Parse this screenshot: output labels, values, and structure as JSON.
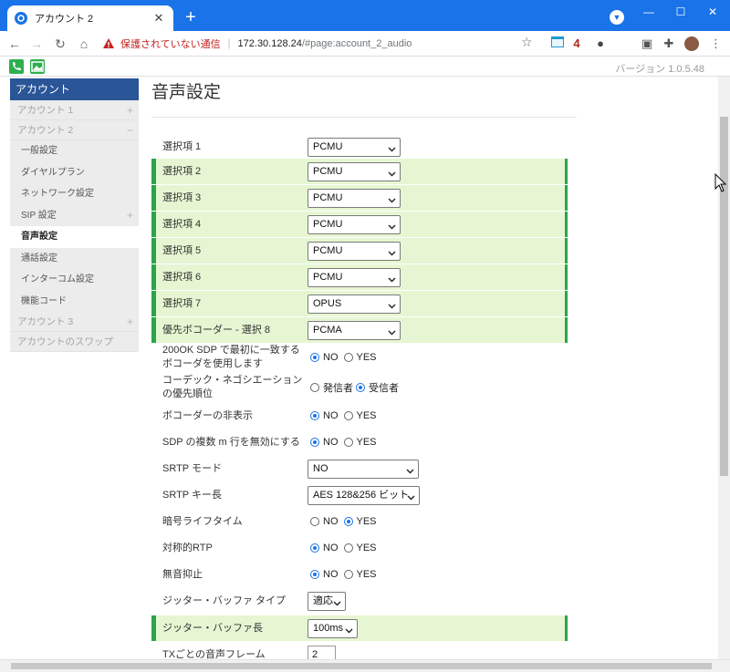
{
  "browser": {
    "tab_title": "アカウント 2",
    "tab_close": "✕",
    "new_tab": "+",
    "window_min": "—",
    "window_max": "☐",
    "window_close": "✕",
    "security_label": "保護されていない通信",
    "url_host": "172.30.128.24",
    "url_path": "/#page:account_2_audio",
    "ext_badge": "4"
  },
  "app": {
    "version": "バージョン 1.0.5.48"
  },
  "sidebar": {
    "header": "アカウント",
    "accounts": [
      {
        "label": "アカウント 1",
        "sign": "+"
      },
      {
        "label": "アカウント 2",
        "sign": "−"
      }
    ],
    "sub_items": [
      {
        "label": "一般設定"
      },
      {
        "label": "ダイヤルプラン"
      },
      {
        "label": "ネットワーク設定"
      },
      {
        "label": "SIP 設定",
        "sign": "+"
      },
      {
        "label": "音声設定"
      },
      {
        "label": "通話設定"
      },
      {
        "label": "インターコム設定"
      },
      {
        "label": "機能コード"
      }
    ],
    "account3": {
      "label": "アカウント 3",
      "sign": "+"
    },
    "swap": "アカウントのスワップ"
  },
  "main": {
    "title": "音声設定",
    "codecs": [
      {
        "label": "選択項 1",
        "value": "PCMU"
      },
      {
        "label": "選択項 2",
        "value": "PCMU"
      },
      {
        "label": "選択項 3",
        "value": "PCMU"
      },
      {
        "label": "選択項 4",
        "value": "PCMU"
      },
      {
        "label": "選択項 5",
        "value": "PCMU"
      },
      {
        "label": "選択項 6",
        "value": "PCMU"
      },
      {
        "label": "選択項 7",
        "value": "OPUS"
      },
      {
        "label": "優先ボコーダー - 選択 8",
        "value": "PCMA"
      }
    ],
    "sdp_first_match": {
      "label": "200OK SDP で最初に一致するボコーダを使用します",
      "opt1": "NO",
      "opt2": "YES"
    },
    "codec_priority": {
      "label": "コーデック・ネゴシエーションの優先順位",
      "opt1": "発信者",
      "opt2": "受信者"
    },
    "hide_vocoder": {
      "label": "ボコーダーの非表示",
      "opt1": "NO",
      "opt2": "YES"
    },
    "disable_multi_m": {
      "label": "SDP の複数 m 行を無効にする",
      "opt1": "NO",
      "opt2": "YES"
    },
    "srtp_mode": {
      "label": "SRTP モード",
      "value": "NO"
    },
    "srtp_key": {
      "label": "SRTP キー長",
      "value": "AES 128&256 ビット"
    },
    "crypto_lifetime": {
      "label": "暗号ライフタイム",
      "opt1": "NO",
      "opt2": "YES"
    },
    "symmetric_rtp": {
      "label": "対称的RTP",
      "opt1": "NO",
      "opt2": "YES"
    },
    "silence_suppression": {
      "label": "無音抑止",
      "opt1": "NO",
      "opt2": "YES"
    },
    "jitter_type": {
      "label": "ジッター・バッファ タイプ",
      "value": "適応"
    },
    "jitter_length": {
      "label": "ジッター・バッファ長",
      "value": "100ms"
    },
    "voice_frames": {
      "label": "TXごとの音声フレーム",
      "value": "2"
    }
  }
}
